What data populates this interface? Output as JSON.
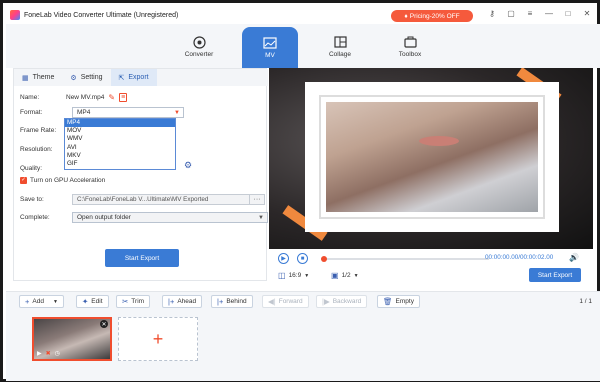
{
  "window": {
    "title": "FoneLab Video Converter Ultimate (Unregistered)",
    "promo": "Pricing-20% OFF",
    "promo_icon": "tag-icon",
    "buttons": [
      "key-icon",
      "feedback-icon",
      "menu-icon",
      "minimize-icon",
      "maximize-icon",
      "close-icon"
    ]
  },
  "nav": {
    "tabs": [
      {
        "label": "Converter",
        "icon": "converter-icon",
        "active": false
      },
      {
        "label": "MV",
        "icon": "mv-icon",
        "active": true
      },
      {
        "label": "Collage",
        "icon": "collage-icon",
        "active": false
      },
      {
        "label": "Toolbox",
        "icon": "toolbox-icon",
        "active": false
      }
    ]
  },
  "subtabs": [
    {
      "label": "Theme",
      "icon": "theme-icon"
    },
    {
      "label": "Setting",
      "icon": "gear-icon"
    },
    {
      "label": "Export",
      "icon": "export-icon",
      "active": true
    }
  ],
  "export": {
    "name_label": "Name:",
    "name_value": "New MV.mp4",
    "format_label": "Format:",
    "format_value": "MP4",
    "format_options": [
      "MP4",
      "MOV",
      "WMV",
      "AVI",
      "MKV",
      "GIF"
    ],
    "frame_rate_label": "Frame Rate:",
    "resolution_label": "Resolution:",
    "quality_label": "Quality:",
    "gpu_label": "Turn on GPU Acceleration",
    "gpu_checked": true,
    "save_to_label": "Save to:",
    "save_to_value": "C:\\FoneLab\\FoneLab V...Ultimate\\MV Exported",
    "browse_label": "···",
    "complete_label": "Complete:",
    "complete_value": "Open output folder",
    "start_export": "Start Export"
  },
  "player": {
    "timecode": "00:00:00.00/00:00:02.00",
    "aspect": "16:9",
    "page": "1/2",
    "progress": 0,
    "start_export": "Start Export"
  },
  "toolbar": {
    "add": "Add",
    "edit": "Edit",
    "trim": "Trim",
    "ahead": "Ahead",
    "behind": "Behind",
    "forward": "Forward",
    "backward": "Backward",
    "empty": "Empty",
    "page_count": "1 / 1"
  },
  "colors": {
    "accent": "#3a7bd5",
    "highlight": "#f04d2e",
    "promo": "#f55a3c"
  }
}
